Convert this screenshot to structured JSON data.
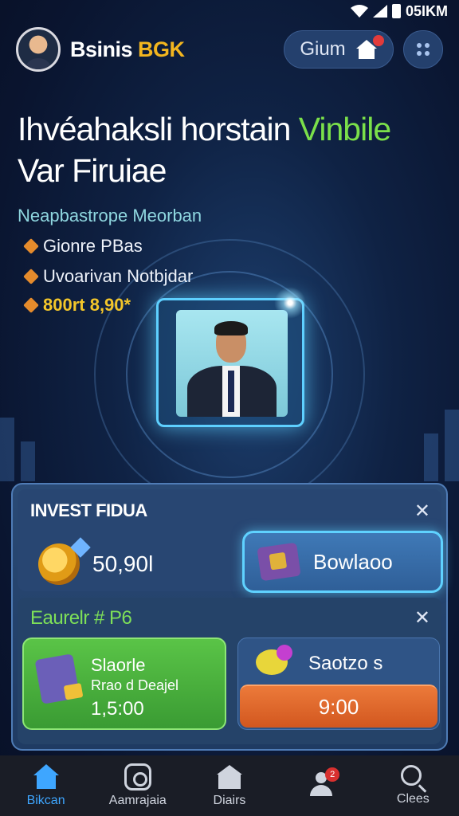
{
  "status_bar": {
    "time": "05IKM"
  },
  "header": {
    "brand_part1": "Bsinis",
    "brand_part2": "BGK",
    "action_label": "Gium"
  },
  "hero": {
    "title_line1": "Ihvéahaksli horstain",
    "title_highlight": "Vinbile",
    "title_line2": "Var Firuiae",
    "subtitle": "Neapbastrope Meorban",
    "features": [
      "Gionre PBas",
      "Uvoarivan Notbjdar"
    ],
    "price": "800rt 8,90*"
  },
  "panel": {
    "title": "INVEST FIDUA",
    "amount": "50,90l",
    "primary_button": "Bowlaoo",
    "section_title": "Eaurelr # P6",
    "green_card": {
      "title": "Slaorle",
      "subtitle": "Rrao d Deajel",
      "value": "1,5:00"
    },
    "blue_card": {
      "title": "Saotzo s",
      "button_value": "9:00"
    }
  },
  "nav": {
    "items": [
      {
        "label": "Bikcan",
        "icon": "home-icon"
      },
      {
        "label": "Aamrajaia",
        "icon": "camera-icon"
      },
      {
        "label": "Diairs",
        "icon": "shop-icon"
      },
      {
        "label": "",
        "icon": "user-icon",
        "badge": "2"
      },
      {
        "label": "Clees",
        "icon": "search-icon"
      }
    ]
  },
  "colors": {
    "accent_green": "#7be04a",
    "brand_gold": "#f3b61f",
    "nav_active": "#3ea6ff",
    "cta_orange": "#d2571f"
  }
}
